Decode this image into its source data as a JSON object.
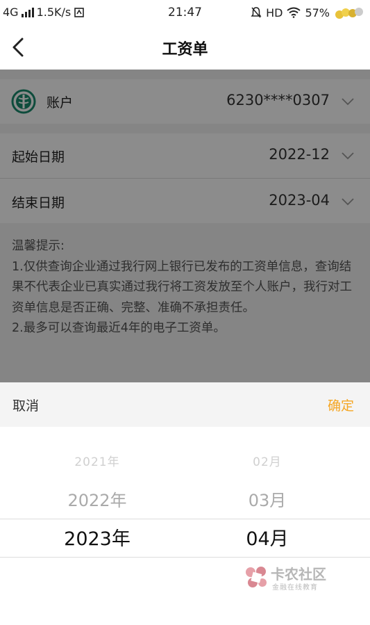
{
  "status_bar": {
    "network": "4G",
    "speed": "1.5K/s",
    "time": "21:47",
    "hd": "HD",
    "battery": "57%"
  },
  "nav": {
    "title": "工资单"
  },
  "form": {
    "account": {
      "label": "账户",
      "value": "6230****0307"
    },
    "start_date": {
      "label": "起始日期",
      "value": "2022-12"
    },
    "end_date": {
      "label": "结束日期",
      "value": "2023-04"
    }
  },
  "tips": {
    "title": "温馨提示:",
    "line1": "1.仅供查询企业通过我行网上银行已发布的工资单信息，查询结果不代表企业已真实通过我行将工资发放至个人账户，我行对工资单信息是否正确、完整、准确不承担责任。",
    "line2": "2.最多可以查询最近4年的电子工资单。"
  },
  "picker": {
    "cancel_label": "取消",
    "confirm_label": "确定",
    "years": [
      "2021年",
      "2022年",
      "2023年"
    ],
    "months": [
      "02月",
      "03月",
      "04月"
    ],
    "selected_year": "2023年",
    "selected_month": "04月"
  },
  "watermark": {
    "title": "卡农社区",
    "subtitle": "金融在线教育"
  },
  "colors": {
    "accent": "#f5a623",
    "bank_green": "#1a8a6e"
  }
}
